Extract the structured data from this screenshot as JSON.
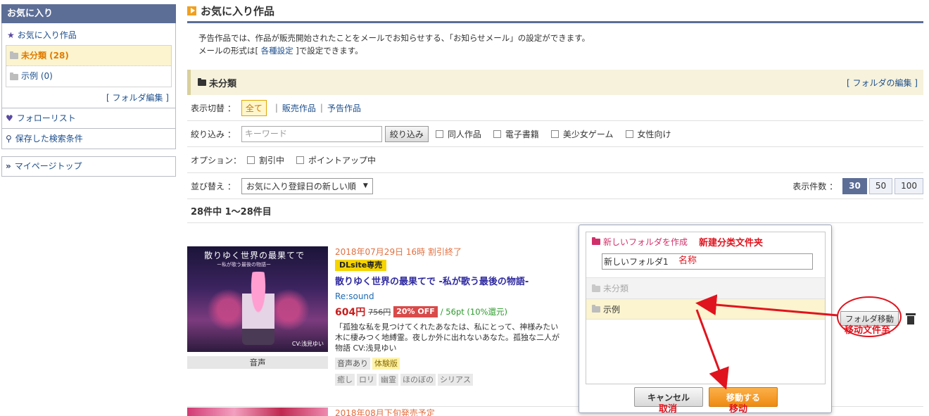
{
  "sidebar": {
    "title": "お気に入り",
    "favorites_label": "お気に入り作品",
    "folders": [
      {
        "label": "未分類 (28)"
      },
      {
        "label": "示例 (0)"
      }
    ],
    "folder_edit": "[ フォルダ編集 ]",
    "follow_label": "フォローリスト",
    "saved_search_label": "保存した検索条件",
    "mypage_label": "マイページトップ"
  },
  "main": {
    "title": "お気に入り作品",
    "intro_line1": "予告作品では、作品が販売開始されたことをメールでお知らせする、「お知らせメール」の設定ができます。",
    "intro_line2_pre": "メールの形式は[ ",
    "intro_link": "各種設定",
    "intro_line2_post": " ]で設定できます。",
    "folder_name": "未分類",
    "folder_edit": "[ フォルダの編集 ]",
    "display_label": "表示切替 ：",
    "display_options": [
      "全て",
      "販売作品",
      "予告作品"
    ],
    "filter_label": "絞り込み ：",
    "keyword_placeholder": "キーワード",
    "filter_button": "絞り込み",
    "filter_checks": [
      "同人作品",
      "電子書籍",
      "美少女ゲーム",
      "女性向け"
    ],
    "option_label": "オプション：",
    "option_checks": [
      "割引中",
      "ポイントアップ中"
    ],
    "sort_label": "並び替え ：",
    "sort_value": "お気に入り登録日の新しい順",
    "count_label": "表示件数 ：",
    "count_options": [
      "30",
      "50",
      "100"
    ],
    "result_text": "28件中 1〜28件目"
  },
  "item": {
    "thumb_title": "散りゆく世界の最果てで",
    "thumb_subtitle": "ー私が歌う最後の物語ー",
    "thumb_cv": "CV:浅見ゆい",
    "thumb_caption": "音声",
    "date": "2018年07月29日 16時 割引終了",
    "badge": "DLsite専売",
    "title": "散りゆく世界の最果てで -私が歌う最後の物語-",
    "maker": "Re:sound",
    "price": "604円",
    "old_price": "756円",
    "discount": "20% OFF",
    "points": "/ 56pt (10%還元)",
    "desc_line1": "「孤独な私を見つけてくれたあなたは、私にとって、神様みたい",
    "desc_line2": "木に棲みつく地縛霊。夜しか外に出れないあなた。孤独な二人が",
    "desc_line3": "物語 CV:浅見ゆい",
    "tags1": [
      "音声あり",
      "体験版"
    ],
    "tags2": [
      "癒し",
      "ロリ",
      "幽霊",
      "ほのぼの",
      "シリアス"
    ],
    "move_button": "フォルダ移動"
  },
  "next_item": {
    "date": "2018年08月下旬発売予定"
  },
  "popup": {
    "new_folder": "新しいフォルダを作成",
    "new_folder_value": "新しいフォルダ1",
    "folders": [
      "未分類",
      "示例"
    ],
    "cancel": "キャンセル",
    "move": "移動する"
  },
  "annotations": {
    "new_folder_cn": "新建分类文件夹",
    "name_cn": "名称",
    "move_to_cn": "移动文件至",
    "cancel_cn": "取消",
    "move_cn": "移动"
  },
  "colors": {
    "header_bg": "#5c6e96",
    "accent_orange": "#e07b00",
    "annotation_red": "#e0141e",
    "highlight_yellow": "#fbf4cf"
  }
}
